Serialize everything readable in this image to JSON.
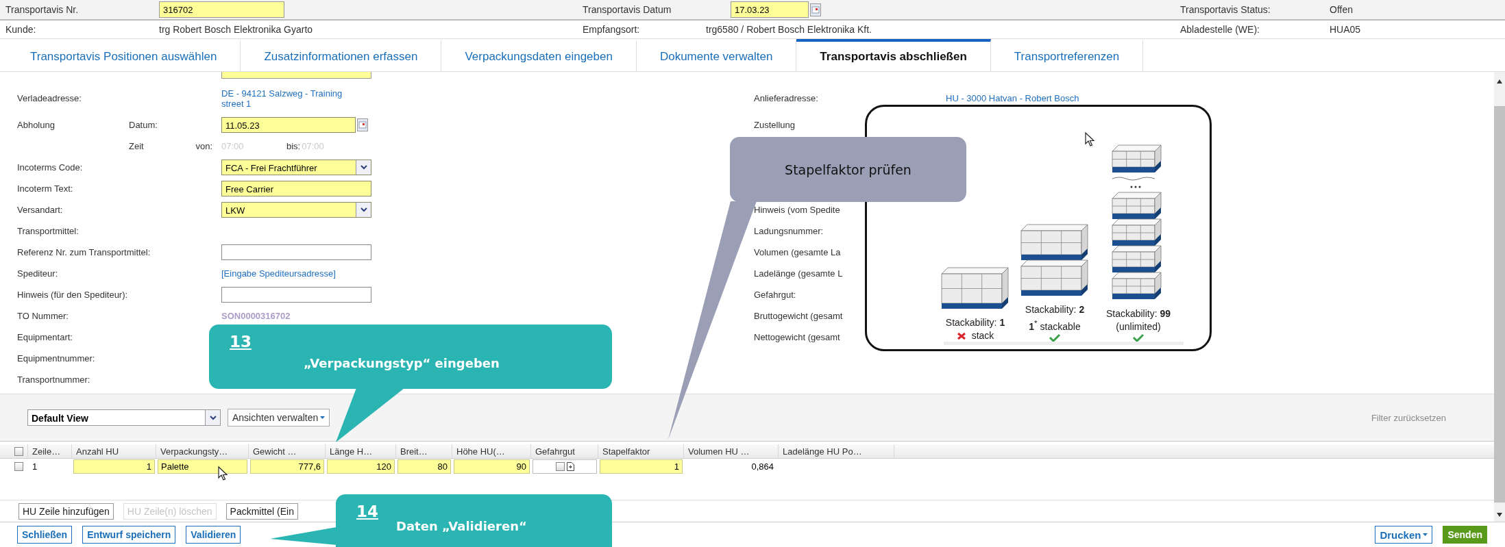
{
  "header": {
    "rows": [
      [
        {
          "label": "Transportavis Nr.",
          "kind": "input",
          "value": "316702"
        },
        {
          "label": "Transportavis Datum",
          "kind": "date",
          "value": "17.03.23"
        },
        {
          "label": "Transportavis Status:",
          "kind": "text",
          "value": "Offen"
        }
      ],
      [
        {
          "label": "Kunde:",
          "kind": "text",
          "value": "trg Robert Bosch Elektronika Gyarto"
        },
        {
          "label": "Empfangsort:",
          "kind": "text",
          "value": "trg6580 / Robert Bosch Elektronika Kft."
        },
        {
          "label": "Abladestelle (WE):",
          "kind": "text",
          "value": "HUA05"
        }
      ]
    ]
  },
  "tabs": [
    {
      "label": "Transportavis Positionen auswählen",
      "selected": false
    },
    {
      "label": "Zusatzinformationen erfassen",
      "selected": false
    },
    {
      "label": "Verpackungsdaten eingeben",
      "selected": false
    },
    {
      "label": "Dokumente verwalten",
      "selected": false
    },
    {
      "label": "Transportavis abschließen",
      "selected": true
    },
    {
      "label": "Transportreferenzen",
      "selected": false
    }
  ],
  "form": {
    "left": [
      {
        "label": "Verladeadresse:",
        "kind": "address",
        "value": "DE - 94121 Salzweg - Training street 1"
      },
      {
        "label": "Abholung",
        "sublabel": "Datum:",
        "kind": "date",
        "value": "11.05.23",
        "required": true
      },
      {
        "sublabel": "Zeit",
        "kind": "time",
        "from_label": "von:",
        "from": "07:00",
        "to_label": "bis:",
        "to": "07:00"
      },
      {
        "label": "Incoterms Code:",
        "kind": "select",
        "value": "FCA - Frei Frachtführer",
        "required": true
      },
      {
        "label": "Incoterm Text:",
        "kind": "input",
        "value": "Free Carrier",
        "required": true
      },
      {
        "label": "Versandart:",
        "kind": "select",
        "value": "LKW",
        "required": true
      },
      {
        "label": "Transportmittel:"
      },
      {
        "label": "Referenz Nr. zum Transportmittel:",
        "kind": "input",
        "required": false
      },
      {
        "label": "Spediteur:",
        "kind": "link",
        "value": "[Eingabe Spediteursadresse]"
      },
      {
        "label": "Hinweis (für den Spediteur):",
        "kind": "input",
        "required": false
      },
      {
        "label": "TO Nummer:",
        "kind": "readonly",
        "value": "SON0000316702"
      },
      {
        "label": "Equipmentart:"
      },
      {
        "label": "Equipmentnummer:"
      },
      {
        "label": "Transportnummer:"
      }
    ],
    "right_top": [
      {
        "label": "Anlieferadresse:",
        "kind": "address",
        "value": "HU - 3000 Hatvan - Robert Bosch"
      },
      {
        "label": "Zustellung"
      }
    ],
    "right_bottom": [
      {
        "label": "Hinweis (vom Spedite"
      },
      {
        "label": "Ladungsnummer:"
      },
      {
        "label": "Volumen (gesamte La"
      },
      {
        "label": "Ladelänge (gesamte L"
      },
      {
        "label": "Gefahrgut:"
      },
      {
        "label": "Bruttogewicht (gesamt"
      },
      {
        "label": "Nettogewicht (gesamt"
      }
    ]
  },
  "toolbar": {
    "view": "Default View",
    "views_button": "Ansichten verwalten",
    "filter_reset": "Filter zurücksetzen"
  },
  "table": {
    "all_selected": false,
    "columns": [
      "Zeile…",
      "Anzahl HU",
      "Verpackungsty…",
      "Gewicht …",
      "Länge H…",
      "Breit…",
      "Höhe HU(…",
      "Gefahrgut",
      "Stapelfaktor",
      "Volumen HU …",
      "Ladelänge HU Po…"
    ],
    "rows": [
      {
        "selected": false,
        "cells": [
          {
            "kind": "text",
            "value": "1",
            "editable": false
          },
          {
            "kind": "number",
            "value": "1",
            "editable": true
          },
          {
            "kind": "text",
            "value": "Palette",
            "editable": true
          },
          {
            "kind": "number",
            "value": "777,6",
            "editable": true
          },
          {
            "kind": "number",
            "value": "120",
            "editable": true
          },
          {
            "kind": "number",
            "value": "80",
            "editable": true
          },
          {
            "kind": "number",
            "value": "90",
            "editable": true
          },
          {
            "kind": "checkbox",
            "checked": false
          },
          {
            "kind": "number",
            "value": "1",
            "editable": true
          },
          {
            "kind": "number",
            "value": "0,864",
            "editable": false
          }
        ]
      }
    ]
  },
  "hu_buttons": [
    {
      "label": "HU Zeile hinzufügen",
      "disabled": false
    },
    {
      "label": "HU Zeile(n) löschen",
      "disabled": true
    },
    {
      "label": "Packmittel (Ein",
      "disabled": false
    }
  ],
  "footer": {
    "left": [
      "Schließen",
      "Entwurf speichern",
      "Validieren"
    ],
    "right": [
      {
        "label": "Drucken",
        "kind": "menu"
      },
      {
        "label": "Senden",
        "kind": "primary"
      }
    ]
  },
  "popup": {
    "stacks": [
      {
        "kind": "single",
        "caption": "Stackability: **1**",
        "note": "stack",
        "ok": false
      },
      {
        "kind": "double",
        "caption": "Stackability: **2**",
        "note": "**1**$^{*}$ stackable",
        "ok": true
      },
      {
        "kind": "unlimited",
        "caption": "Stackability: **99**",
        "note": "(unlimited)",
        "ok": true
      }
    ]
  },
  "callouts": [
    {
      "kind": "step",
      "number": "13",
      "text": "„Verpackungstyp“ eingeben"
    },
    {
      "kind": "step",
      "number": "14",
      "text": "Daten „Validieren“"
    },
    {
      "kind": "note",
      "text": "Stapelfaktor prüfen"
    }
  ]
}
